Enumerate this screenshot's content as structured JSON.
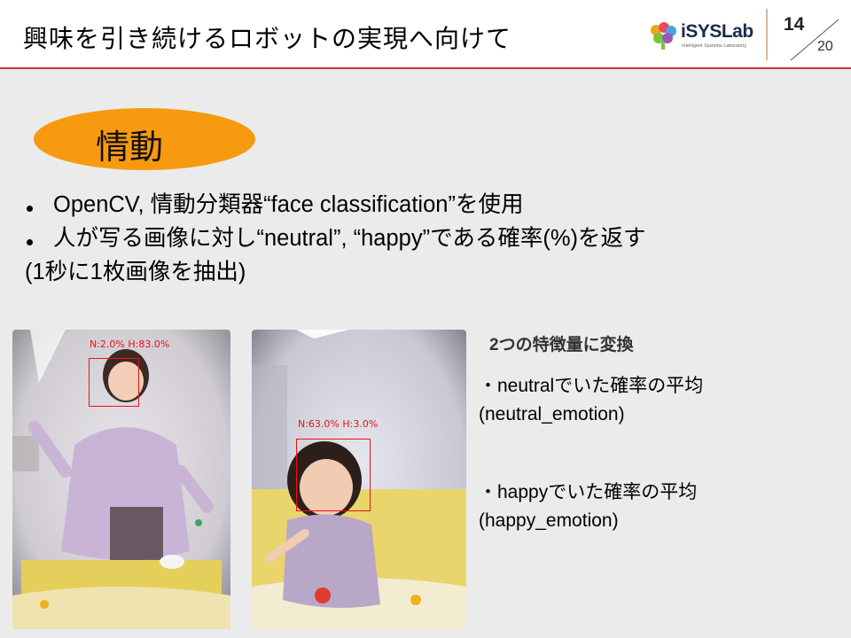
{
  "header": {
    "title": "興味を引き続けるロボットの実現へ向けて",
    "logo": {
      "name": "iSYSLab",
      "subtitle": "Intelligent Systems Laboratory"
    },
    "page_number": "14",
    "page_total": "20"
  },
  "section": {
    "label": "情動"
  },
  "bullets": [
    "OpenCV,  情動分類器“face classification”を使用",
    "人が写る画像に対し“neutral”, “happy”である確率(%)を返す"
  ],
  "note": "(1秒に1枚画像を抽出)",
  "photos": [
    {
      "detection_label": "N:2.0% H:83.0%"
    },
    {
      "detection_label": "N:63.0% H:3.0%"
    }
  ],
  "features": {
    "title": "2つの特徴量に変換",
    "items": [
      {
        "line1": "・neutralでいた確率の平均",
        "line2": "(neutral_emotion)"
      },
      {
        "line1": "・happyでいた確率の平均",
        "line2": "(happy_emotion)"
      }
    ]
  },
  "colors": {
    "accent_orange": "#f79a0f",
    "header_rule": "#c0392b",
    "detection": "#ee1111"
  }
}
